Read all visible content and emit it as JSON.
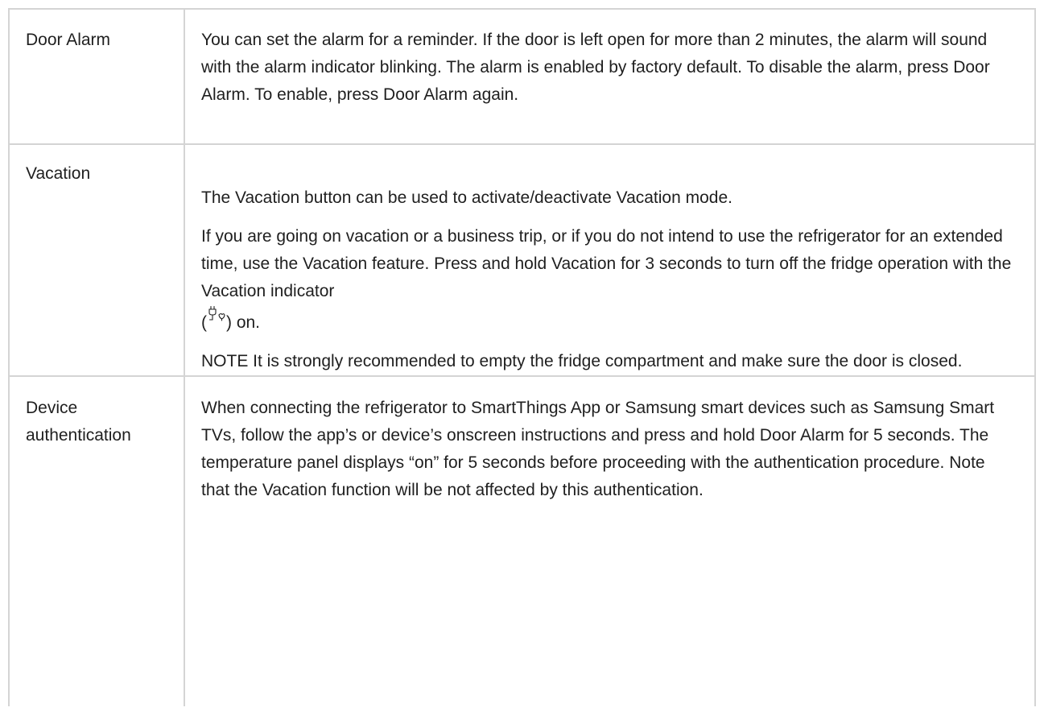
{
  "rows": [
    {
      "label": "Door Alarm",
      "paragraphs": [
        "You can set the alarm for a reminder. If the door is left open for more than 2 minutes, the alarm will sound with the alarm indicator blinking. The alarm is enabled by factory default. To disable the alarm, press Door Alarm. To enable, press Door Alarm again."
      ]
    },
    {
      "label": "Vacation",
      "paragraphs": [
        "The Vacation button can be used to activate/deactivate Vacation mode.",
        "If you are going on vacation or a business trip, or if you do not intend to use the refrigerator for an extended time, use the Vacation feature. Press and hold Vacation for 3 seconds to turn off the fridge operation with the Vacation indicator",
        "NOTE It is strongly recommended to empty the fridge compartment and make sure the door is closed."
      ],
      "indicator_open": "(",
      "indicator_close": ") on.",
      "indicator_icon": "vacation-plug-leaf-icon"
    },
    {
      "label_line1": "Device",
      "label_line2": "authentication",
      "paragraphs": [
        "When connecting the refrigerator to SmartThings App or Samsung smart devices such as Samsung Smart TVs, follow the app’s or device’s onscreen instructions and press and hold Door Alarm for 5 seconds. The temperature panel displays “on” for 5 seconds before proceeding with the authentication procedure. Note that the Vacation function will be not affected by this authentication."
      ]
    }
  ],
  "colors": {
    "border": "#d4d4d4",
    "text": "#1f1f1f"
  }
}
